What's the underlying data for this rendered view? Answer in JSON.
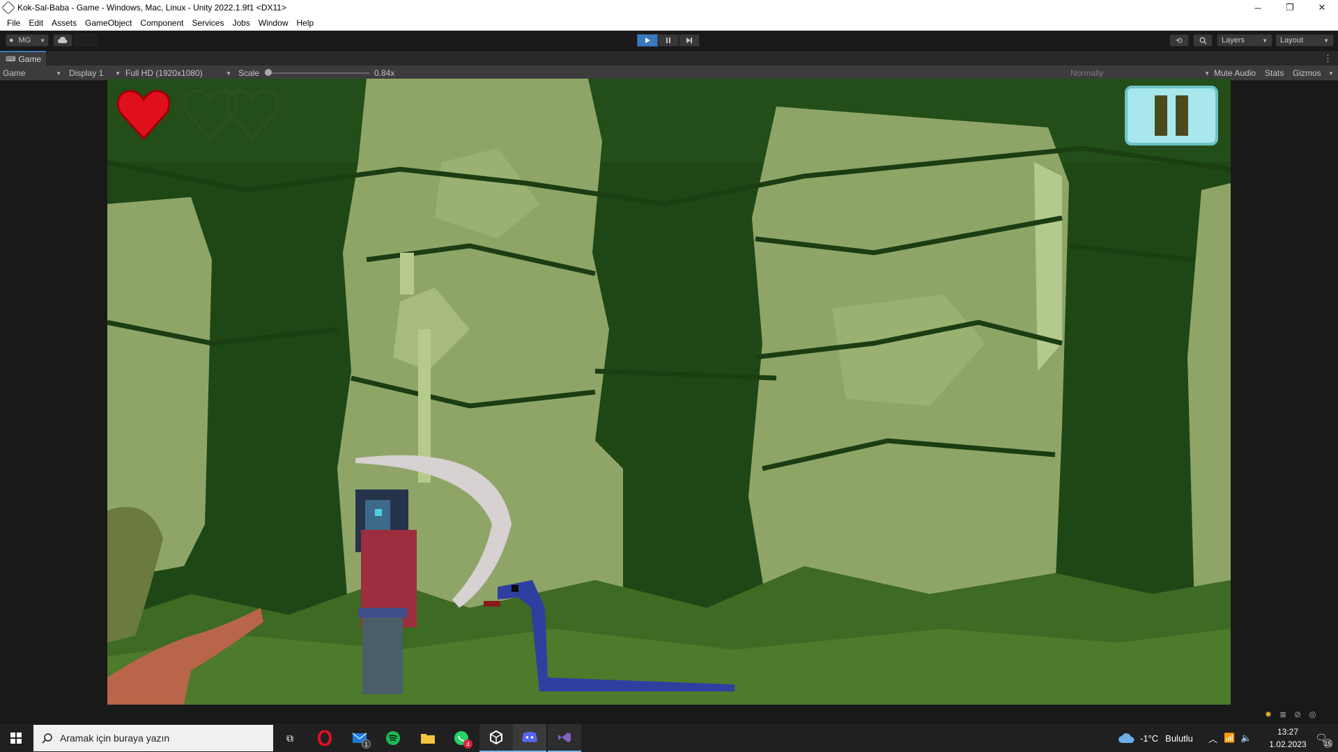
{
  "window": {
    "title": "Kok-Sal-Baba - Game - Windows, Mac, Linux - Unity 2022.1.9f1 <DX11>",
    "controls": [
      "─",
      "❐",
      "✕"
    ]
  },
  "menu": [
    "File",
    "Edit",
    "Assets",
    "GameObject",
    "Component",
    "Services",
    "Jobs",
    "Window",
    "Help"
  ],
  "toolbar": {
    "account_label": "MG",
    "layers_label": "Layers",
    "layout_label": "Layout"
  },
  "tab": {
    "label": "Game"
  },
  "game_view": {
    "mode": "Game",
    "display": "Display 1",
    "resolution": "Full HD (1920x1080)",
    "scale_label": "Scale",
    "scale_value": "0.84x",
    "scale_fraction": 0.0,
    "render_mode": "Normally",
    "mute_audio": "Mute Audio",
    "stats": "Stats",
    "gizmos": "Gizmos"
  },
  "hud": {
    "hearts_total": 3,
    "hearts_filled": 1,
    "pause_icon": "pause-icon"
  },
  "taskbar": {
    "search_placeholder": "Aramak için buraya yazın",
    "mail_badge": "1",
    "whatsapp_badge": "4",
    "weather_temp": "-1°C",
    "weather_text": "Bulutlu",
    "time": "13:27",
    "date": "1.02.2023",
    "notification_count": "15"
  },
  "colors": {
    "accent": "#3a79bb",
    "heart_red": "#e0101a",
    "forest_dark": "#1f4716",
    "foliage_light": "#8fa568"
  }
}
